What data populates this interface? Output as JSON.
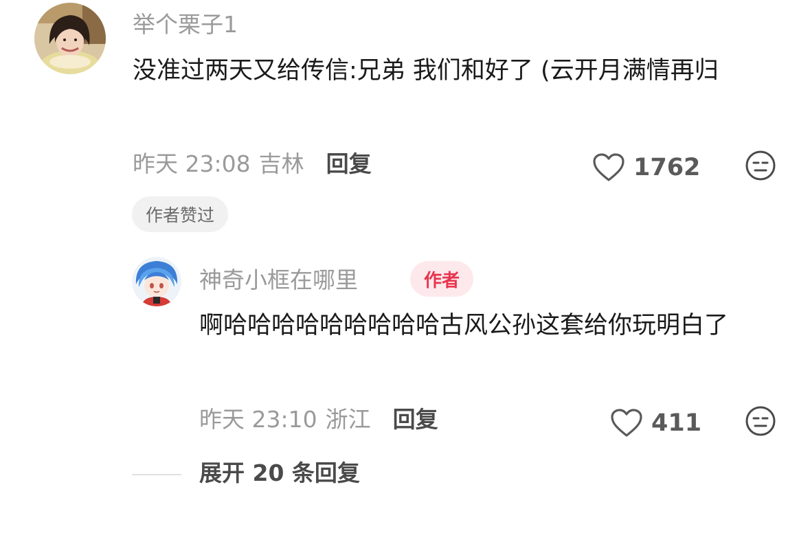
{
  "comment": {
    "username": "举个栗子1",
    "text": "没准过两天又给传信:兄弟 我们和好了 (云开月满情再归",
    "time": "昨天 23:08",
    "location": "吉林",
    "reply_label": "回复",
    "like_count": "1762",
    "author_liked_badge": "作者赞过",
    "icons": {
      "avatar": "user-avatar-photo",
      "like": "heart-outline-icon",
      "dislike": "unamused-face-icon"
    }
  },
  "reply": {
    "username": "神奇小框在哪里",
    "author_badge": "作者",
    "text": "啊哈哈哈哈哈哈哈哈哈古风公孙这套给你玩明白了",
    "time": "昨天 23:10",
    "location": "浙江",
    "reply_label": "回复",
    "like_count": "411",
    "icons": {
      "avatar": "anime-character-avatar",
      "like": "heart-outline-icon",
      "dislike": "unamused-face-icon"
    }
  },
  "expand": {
    "label": "展开 20 条回复"
  },
  "colors": {
    "muted_text": "#9a9a9a",
    "body_text": "#1a1a1a",
    "author_badge_bg": "#fde9ec",
    "author_badge_text": "#e8344e",
    "liked_badge_bg": "#f1f1f1"
  }
}
